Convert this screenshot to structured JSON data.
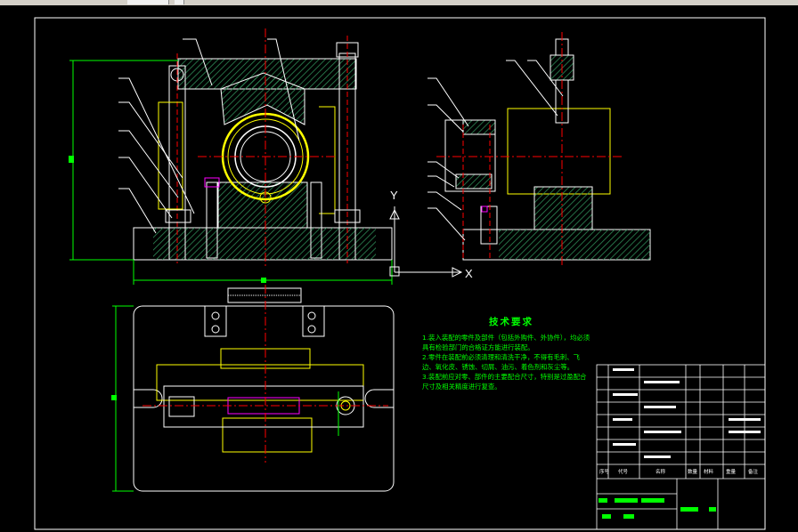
{
  "window": {
    "menu_tabs": [
      "",
      "",
      ""
    ]
  },
  "technical_requirements": {
    "title": "技术要求",
    "items": [
      "1.装入装配的零件及部件（包括外购件、外协件），均必须具有检验部门的合格证方能进行装配。",
      "2.零件在装配前必须清理和清洗干净，不得有毛刺、飞边、氧化皮、锈蚀、切屑、油污、着色剂和灰尘等。",
      "3.装配前应对零、部件的主要配合尺寸，特别是过盈配合尺寸及相关精度进行复查。"
    ]
  },
  "axis_labels": {
    "x": "X",
    "y": "Y"
  },
  "title_block": {
    "header": [
      "序号",
      "代号",
      "名称",
      "数量",
      "材料",
      "重量",
      "备注"
    ]
  },
  "colors": {
    "background": "#000000",
    "outline": "#ffffff",
    "hatch": "#2e8b57",
    "centerline": "#ff0000",
    "dimension": "#00ff00",
    "bearing": "#ffff00",
    "highlight": "#ff00ff"
  }
}
